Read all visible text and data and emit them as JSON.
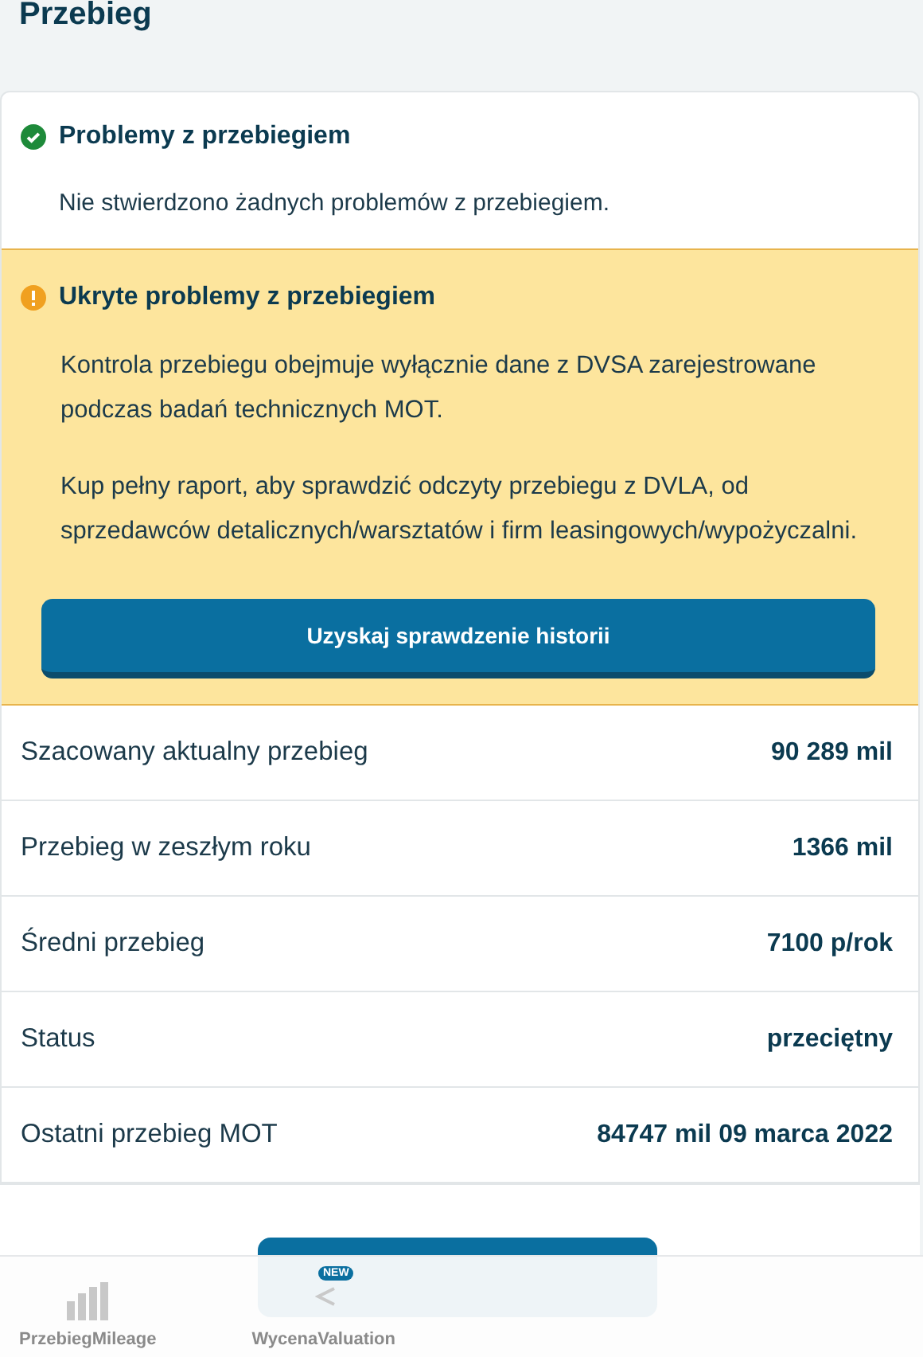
{
  "page_title": "Przebieg",
  "ok_section": {
    "title": "Problemy z przebiegiem",
    "text": "Nie stwierdzono żadnych problemów z przebiegiem."
  },
  "warning_section": {
    "title": "Ukryte problemy z przebiegiem",
    "paragraphs": [
      "Kontrola przebiegu obejmuje wyłącznie dane z DVSA zarejestrowane podczas badań technicznych MOT.",
      "Kup pełny raport, aby sprawdzić odczyty przebiegu z DVLA, od sprzedawców detalicznych/warsztatów i firm leasingowych/wypożyczalni."
    ],
    "button": "Uzyskaj sprawdzenie historii"
  },
  "rows": [
    {
      "label": "Szacowany aktualny przebieg",
      "value": "90 289 mil"
    },
    {
      "label": "Przebieg w zeszłym roku",
      "value": "1366 mil"
    },
    {
      "label": "Średni przebieg",
      "value": "7100 p/rok"
    },
    {
      "label": "Status",
      "value": "przeciętny"
    },
    {
      "label": "Ostatni przebieg MOT",
      "value": "84747 mil 09 marca 2022"
    }
  ],
  "overlay_badge": "NEW",
  "bottom_nav": [
    {
      "label": "PrzebiegMileage",
      "kind": "with-icon"
    },
    {
      "label": "WycenaValuation",
      "kind": "text-only"
    }
  ]
}
